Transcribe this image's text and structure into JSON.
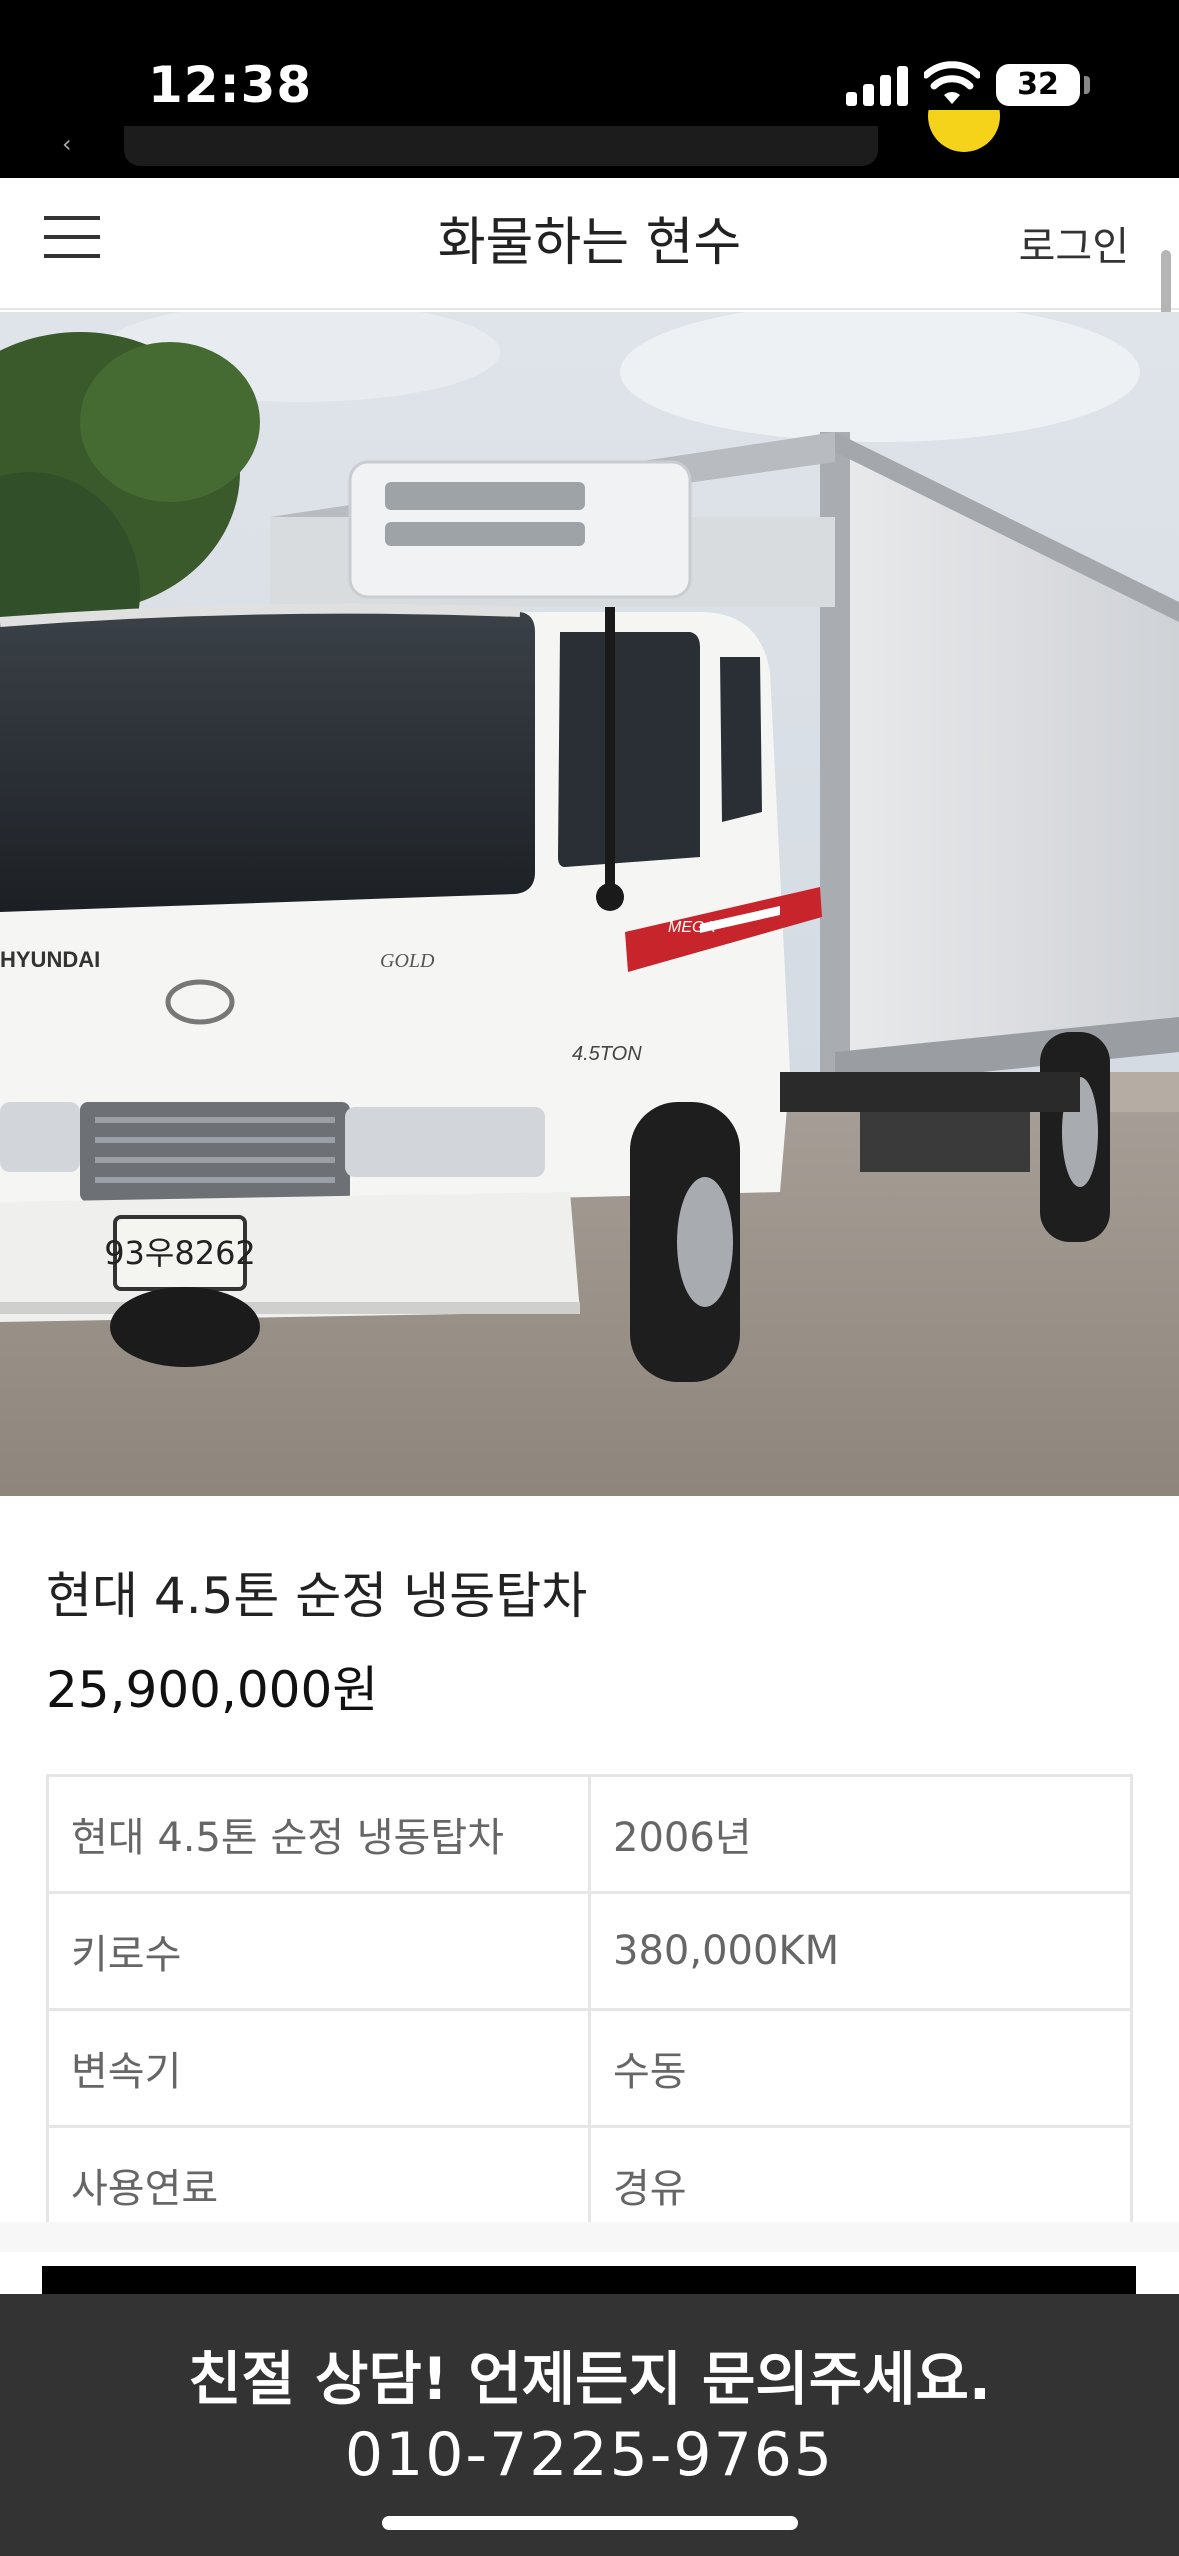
{
  "status_bar": {
    "time": "12:38",
    "battery": "32",
    "icons": [
      "cellular-signal-icon",
      "wifi-icon",
      "battery-icon"
    ]
  },
  "header": {
    "menu_icon": "hamburger-menu-icon",
    "title": "화물하는 현수",
    "login_label": "로그인"
  },
  "hero": {
    "plate_text": "93우8262",
    "brand_text": "HYUNDAI",
    "model_text": "GOLD",
    "stripe_text": "MEGA",
    "tonnage_text": "4.5TON"
  },
  "product": {
    "title": "현대 4.5톤 순정 냉동탑차",
    "price": "25,900,000원"
  },
  "specs": [
    {
      "key": "현대 4.5톤 순정 냉동탑차",
      "value": "2006년"
    },
    {
      "key": "키로수",
      "value": "380,000KM"
    },
    {
      "key": "변속기",
      "value": "수동"
    },
    {
      "key": "사용연료",
      "value": "경유"
    }
  ],
  "contact": {
    "line1": "친절 상담! 언제든지 문의주세요.",
    "phone": "010-7225-9765"
  },
  "colors": {
    "status_bar_bg": "#000000",
    "contact_banner_bg": "#333333",
    "accent_red": "#c8242b",
    "table_border": "#e6e6e6"
  }
}
